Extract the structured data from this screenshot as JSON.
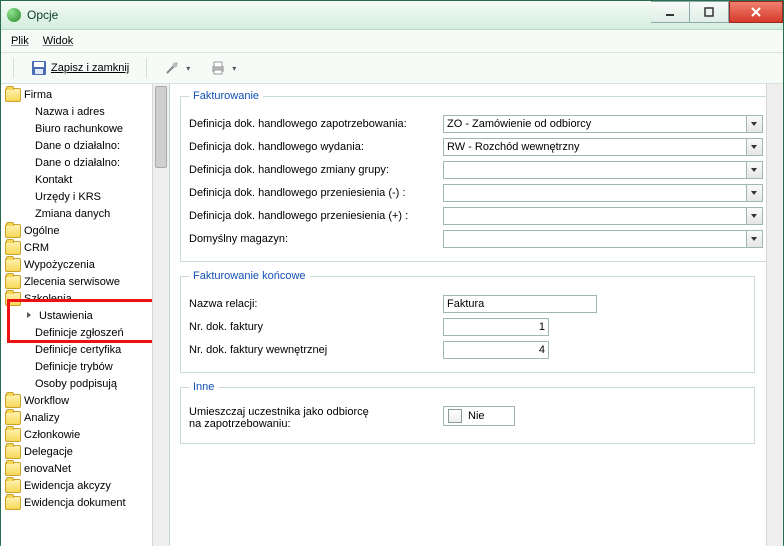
{
  "window": {
    "title": "Opcje"
  },
  "menu": {
    "file": "Plik",
    "view": "Widok"
  },
  "toolbar": {
    "save_close": "Zapisz i zamknij"
  },
  "tree": {
    "firma": {
      "label": "Firma",
      "children": {
        "nazwa": "Nazwa i adres",
        "biuro": "Biuro rachunkowe",
        "dane1": "Dane o działalno:",
        "dane2": "Dane o działalno:",
        "kontakt": "Kontakt",
        "urzedy": "Urzędy i KRS",
        "zmiana": "Zmiana danych"
      }
    },
    "ogolne": "Ogólne",
    "crm": "CRM",
    "wypozyczenia": "Wypożyczenia",
    "zlecenia": "Zlecenia serwisowe",
    "szkolenia": {
      "label": "Szkolenia",
      "children": {
        "ustawienia": "Ustawienia",
        "def_zgl": "Definicje zgłoszeń",
        "def_cert": "Definicje certyfika",
        "def_tryb": "Definicje trybów",
        "osoby": "Osoby podpisują"
      }
    },
    "workflow": "Workflow",
    "analizy": "Analizy",
    "czlonkowie": "Członkowie",
    "delegacje": "Delegacje",
    "enovanet": "enovaNet",
    "ewid_akcyzy": "Ewidencja akcyzy",
    "ewid_dok": "Ewidencja dokument"
  },
  "fakturowanie": {
    "legend": "Fakturowanie",
    "rows": {
      "def_zap_label": "Definicja dok. handlowego zapotrzebowania:",
      "def_zap_value": "ZO - Zamówienie od odbiorcy",
      "def_wyd_label": "Definicja dok. handlowego wydania:",
      "def_wyd_value": "RW - Rozchód wewnętrzny",
      "def_zg_label": "Definicja dok. handlowego zmiany grupy:",
      "def_zg_value": "",
      "def_pm_label": "Definicja dok. handlowego przeniesienia (-) :",
      "def_pm_value": "",
      "def_pp_label": "Definicja dok. handlowego przeniesienia (+) :",
      "def_pp_value": "",
      "mag_label": "Domyślny magazyn:",
      "mag_value": ""
    }
  },
  "fakt_koncowe": {
    "legend": "Fakturowanie końcowe",
    "nazwa_label": "Nazwa relacji:",
    "nazwa_value": "Faktura",
    "nr_label": "Nr. dok. faktury",
    "nr_value": "1",
    "nrw_label": "Nr. dok. faktury wewnętrznej",
    "nrw_value": "4"
  },
  "inne": {
    "legend": "Inne",
    "um_label1": "Umieszczaj uczestnika jako odbiorcę",
    "um_label2": "na zapotrzebowaniu:",
    "um_value": "Nie"
  }
}
